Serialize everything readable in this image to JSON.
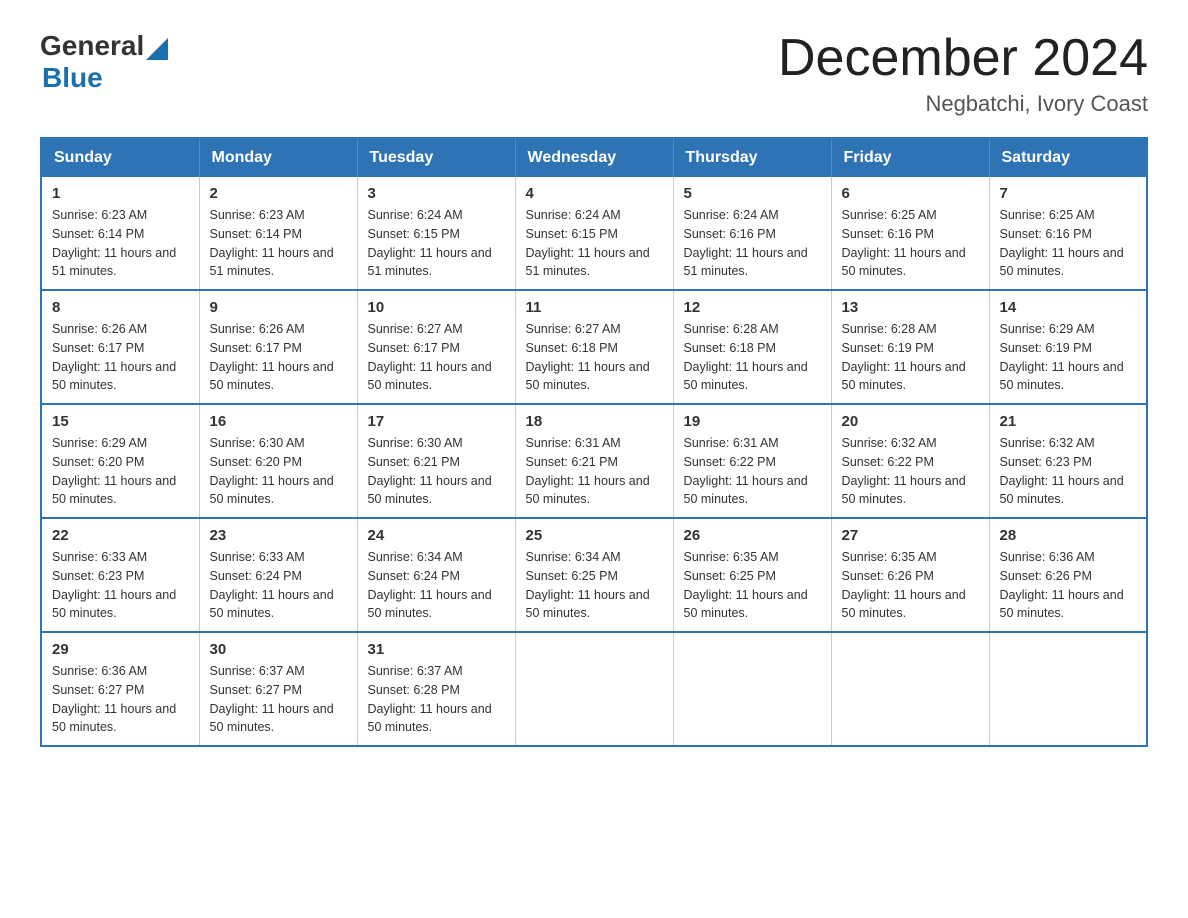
{
  "logo": {
    "general": "General",
    "arrow": "▲",
    "blue": "Blue"
  },
  "title": "December 2024",
  "location": "Negbatchi, Ivory Coast",
  "days_of_week": [
    "Sunday",
    "Monday",
    "Tuesday",
    "Wednesday",
    "Thursday",
    "Friday",
    "Saturday"
  ],
  "weeks": [
    [
      {
        "day": "1",
        "sunrise": "6:23 AM",
        "sunset": "6:14 PM",
        "daylight": "11 hours and 51 minutes."
      },
      {
        "day": "2",
        "sunrise": "6:23 AM",
        "sunset": "6:14 PM",
        "daylight": "11 hours and 51 minutes."
      },
      {
        "day": "3",
        "sunrise": "6:24 AM",
        "sunset": "6:15 PM",
        "daylight": "11 hours and 51 minutes."
      },
      {
        "day": "4",
        "sunrise": "6:24 AM",
        "sunset": "6:15 PM",
        "daylight": "11 hours and 51 minutes."
      },
      {
        "day": "5",
        "sunrise": "6:24 AM",
        "sunset": "6:16 PM",
        "daylight": "11 hours and 51 minutes."
      },
      {
        "day": "6",
        "sunrise": "6:25 AM",
        "sunset": "6:16 PM",
        "daylight": "11 hours and 50 minutes."
      },
      {
        "day": "7",
        "sunrise": "6:25 AM",
        "sunset": "6:16 PM",
        "daylight": "11 hours and 50 minutes."
      }
    ],
    [
      {
        "day": "8",
        "sunrise": "6:26 AM",
        "sunset": "6:17 PM",
        "daylight": "11 hours and 50 minutes."
      },
      {
        "day": "9",
        "sunrise": "6:26 AM",
        "sunset": "6:17 PM",
        "daylight": "11 hours and 50 minutes."
      },
      {
        "day": "10",
        "sunrise": "6:27 AM",
        "sunset": "6:17 PM",
        "daylight": "11 hours and 50 minutes."
      },
      {
        "day": "11",
        "sunrise": "6:27 AM",
        "sunset": "6:18 PM",
        "daylight": "11 hours and 50 minutes."
      },
      {
        "day": "12",
        "sunrise": "6:28 AM",
        "sunset": "6:18 PM",
        "daylight": "11 hours and 50 minutes."
      },
      {
        "day": "13",
        "sunrise": "6:28 AM",
        "sunset": "6:19 PM",
        "daylight": "11 hours and 50 minutes."
      },
      {
        "day": "14",
        "sunrise": "6:29 AM",
        "sunset": "6:19 PM",
        "daylight": "11 hours and 50 minutes."
      }
    ],
    [
      {
        "day": "15",
        "sunrise": "6:29 AM",
        "sunset": "6:20 PM",
        "daylight": "11 hours and 50 minutes."
      },
      {
        "day": "16",
        "sunrise": "6:30 AM",
        "sunset": "6:20 PM",
        "daylight": "11 hours and 50 minutes."
      },
      {
        "day": "17",
        "sunrise": "6:30 AM",
        "sunset": "6:21 PM",
        "daylight": "11 hours and 50 minutes."
      },
      {
        "day": "18",
        "sunrise": "6:31 AM",
        "sunset": "6:21 PM",
        "daylight": "11 hours and 50 minutes."
      },
      {
        "day": "19",
        "sunrise": "6:31 AM",
        "sunset": "6:22 PM",
        "daylight": "11 hours and 50 minutes."
      },
      {
        "day": "20",
        "sunrise": "6:32 AM",
        "sunset": "6:22 PM",
        "daylight": "11 hours and 50 minutes."
      },
      {
        "day": "21",
        "sunrise": "6:32 AM",
        "sunset": "6:23 PM",
        "daylight": "11 hours and 50 minutes."
      }
    ],
    [
      {
        "day": "22",
        "sunrise": "6:33 AM",
        "sunset": "6:23 PM",
        "daylight": "11 hours and 50 minutes."
      },
      {
        "day": "23",
        "sunrise": "6:33 AM",
        "sunset": "6:24 PM",
        "daylight": "11 hours and 50 minutes."
      },
      {
        "day": "24",
        "sunrise": "6:34 AM",
        "sunset": "6:24 PM",
        "daylight": "11 hours and 50 minutes."
      },
      {
        "day": "25",
        "sunrise": "6:34 AM",
        "sunset": "6:25 PM",
        "daylight": "11 hours and 50 minutes."
      },
      {
        "day": "26",
        "sunrise": "6:35 AM",
        "sunset": "6:25 PM",
        "daylight": "11 hours and 50 minutes."
      },
      {
        "day": "27",
        "sunrise": "6:35 AM",
        "sunset": "6:26 PM",
        "daylight": "11 hours and 50 minutes."
      },
      {
        "day": "28",
        "sunrise": "6:36 AM",
        "sunset": "6:26 PM",
        "daylight": "11 hours and 50 minutes."
      }
    ],
    [
      {
        "day": "29",
        "sunrise": "6:36 AM",
        "sunset": "6:27 PM",
        "daylight": "11 hours and 50 minutes."
      },
      {
        "day": "30",
        "sunrise": "6:37 AM",
        "sunset": "6:27 PM",
        "daylight": "11 hours and 50 minutes."
      },
      {
        "day": "31",
        "sunrise": "6:37 AM",
        "sunset": "6:28 PM",
        "daylight": "11 hours and 50 minutes."
      },
      null,
      null,
      null,
      null
    ]
  ]
}
